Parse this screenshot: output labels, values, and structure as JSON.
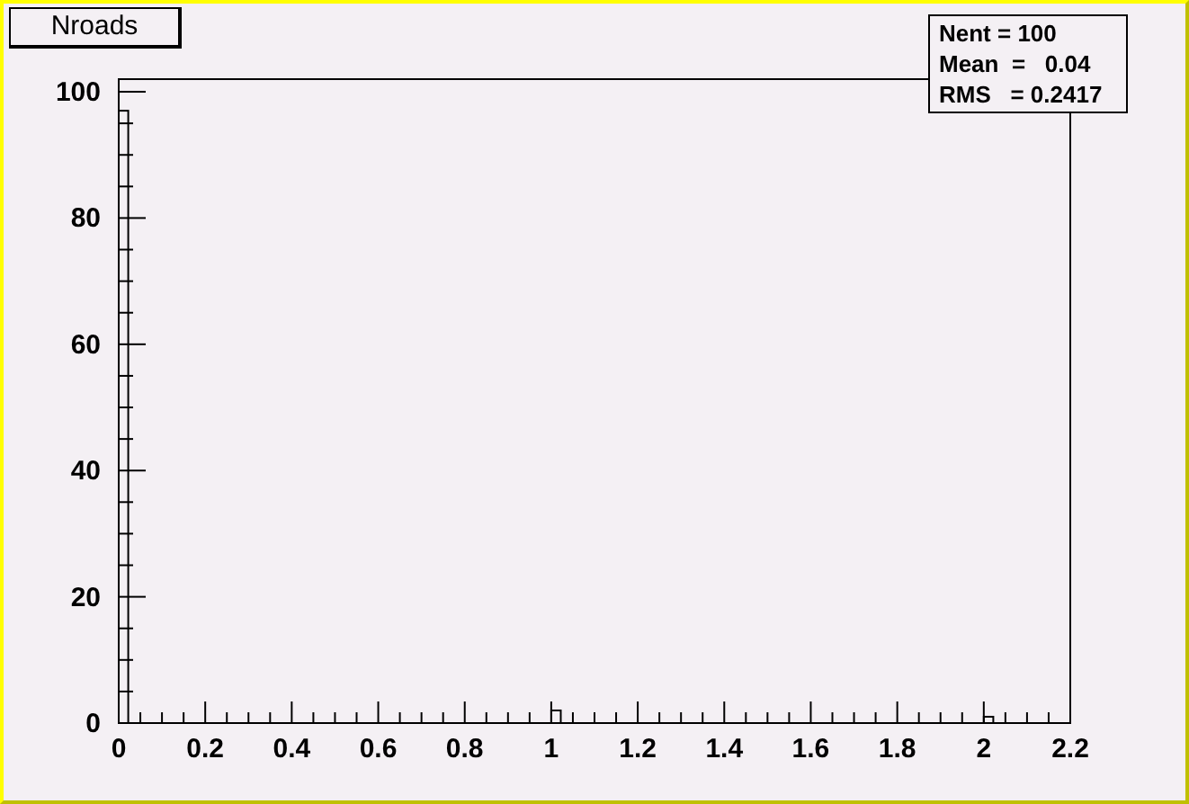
{
  "title_box": {
    "text": "Nroads"
  },
  "stats_box": {
    "rows": [
      "Nent = 100",
      "Mean  =   0.04",
      "RMS   = 0.2417"
    ]
  },
  "chart_data": {
    "type": "bar",
    "x": [
      0,
      1,
      2
    ],
    "values": [
      97,
      2,
      1
    ],
    "xlim": [
      0,
      2.2
    ],
    "ylim": [
      0,
      102
    ],
    "xticks": [
      0,
      0.2,
      0.4,
      0.6,
      0.8,
      1,
      1.2,
      1.4,
      1.6,
      1.8,
      2,
      2.2
    ],
    "yticks": [
      0,
      20,
      40,
      60,
      80,
      100
    ]
  }
}
